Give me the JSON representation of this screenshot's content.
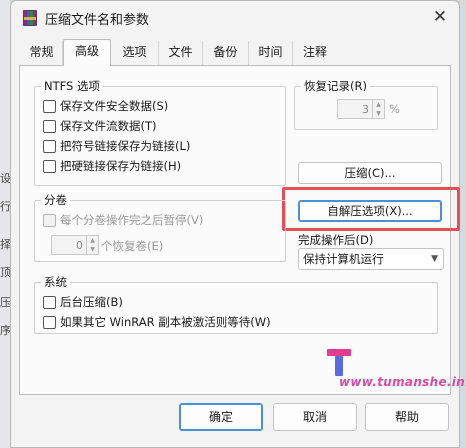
{
  "edge_chars": [
    "设",
    "行",
    "择",
    "顶",
    "压",
    "序"
  ],
  "window": {
    "title": "压缩文件名和参数",
    "close_glyph": "✕"
  },
  "tabs": [
    "常规",
    "高级",
    "选项",
    "文件",
    "备份",
    "时间",
    "注释"
  ],
  "active_tab": "高级",
  "ntfs": {
    "title": "NTFS 选项",
    "options": [
      "保存文件安全数据(S)",
      "保存文件流数据(T)",
      "把符号链接保存为链接(L)",
      "把硬链接保存为链接(H)"
    ]
  },
  "recovery": {
    "title": "恢复记录(R)",
    "value": "3",
    "unit": "%"
  },
  "volumes": {
    "title": "分卷",
    "pause_option": "每个分卷操作完之后暂停(V)",
    "recovery_volumes_value": "0",
    "recovery_volumes_label": "个恢复卷(E)"
  },
  "buttons": {
    "compression": "压缩(C)...",
    "sfx_options": "自解压选项(X)...",
    "ok": "确定",
    "cancel": "取消",
    "help": "帮助"
  },
  "after_completion": {
    "label": "完成操作后(D)",
    "selected": "保持计算机运行"
  },
  "system": {
    "title": "系统",
    "options": [
      "后台压缩(B)",
      "如果其它 WinRAR 副本被激活则等待(W)"
    ]
  },
  "watermark": "www.tumanshe.info",
  "colors": {
    "highlight": "#e0515a",
    "primary_border": "#4d8fd6"
  }
}
